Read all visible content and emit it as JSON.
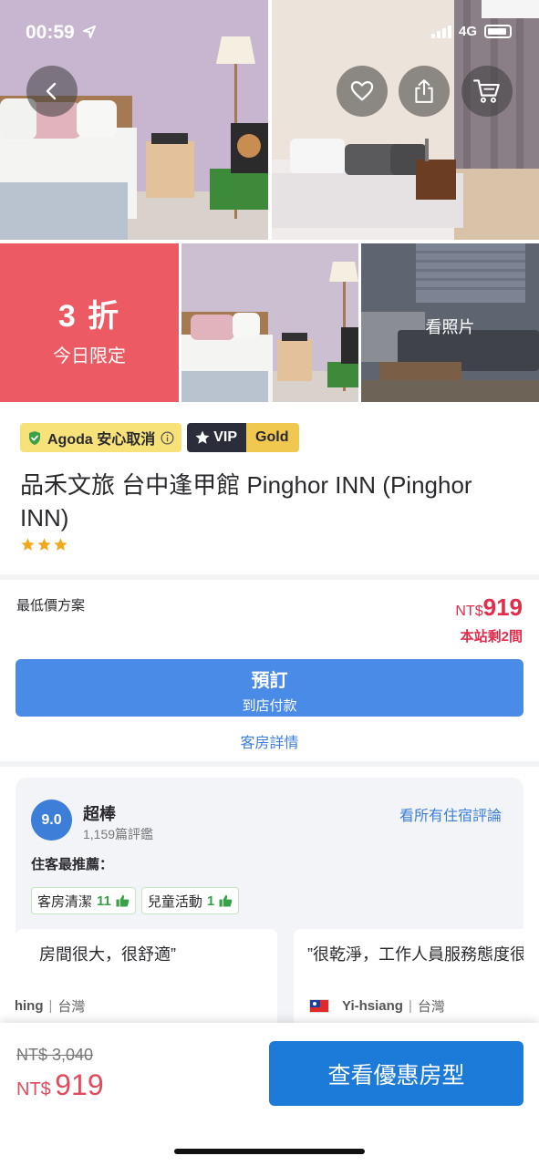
{
  "status_bar": {
    "time": "00:59",
    "network": "4G"
  },
  "gallery": {
    "promo_discount": "3 折",
    "promo_subtitle": "今日限定",
    "view_photos": "看照片"
  },
  "hotel": {
    "badge_agoda": "Agoda 安心取消",
    "badge_vip": "VIP",
    "badge_gold": "Gold",
    "name": "品禾文旅 台中逢甲館 Pinghor INN (Pinghor INN)",
    "star_rating": 3
  },
  "price_plan": {
    "label": "最低價方案",
    "currency": "NT$",
    "price": "919",
    "rooms_left": "本站剩2間",
    "book_label": "預訂",
    "book_sublabel": "到店付款",
    "room_details": "客房詳情"
  },
  "reviews": {
    "score": "9.0",
    "score_word": "超棒",
    "count": "1,159篇評鑑",
    "see_all": "看所有住宿評論",
    "recommend_title": "住客最推薦：",
    "tags": [
      {
        "label": "客房清潔",
        "count": "11"
      },
      {
        "label": "兒童活動",
        "count": "1"
      }
    ],
    "quotes": [
      {
        "text": "房間很大，很舒適”",
        "author": "Ching",
        "country": "台灣"
      },
      {
        "text": "”很乾淨，工作人員服務態度很好",
        "author": "Yi-hsiang",
        "country": "台灣"
      }
    ]
  },
  "bottom_bar": {
    "old_price": "NT$ 3,040",
    "currency": "NT$",
    "new_price": "919",
    "cta": "查看優惠房型"
  },
  "colors": {
    "accent_blue": "#4a8be8",
    "price_red": "#e12d4b",
    "promo_red": "#ec5b64",
    "cta_blue": "#1c7bd8"
  }
}
